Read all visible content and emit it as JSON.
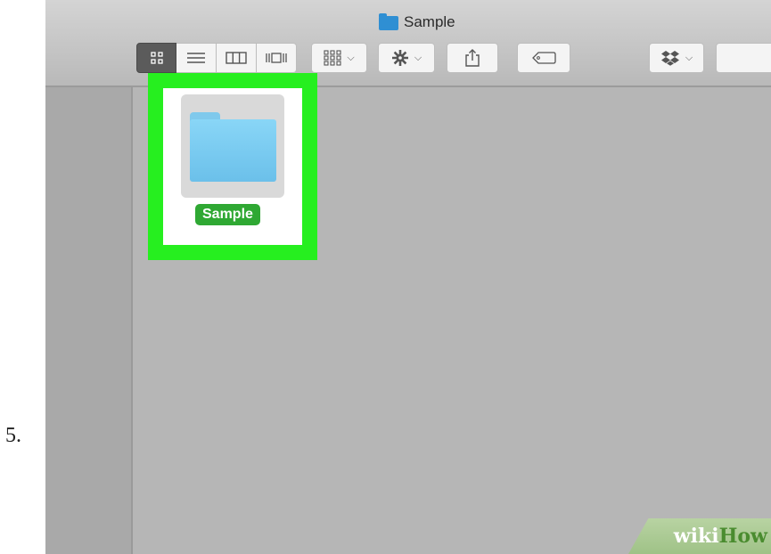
{
  "step_number": "5.",
  "window": {
    "title": "Sample",
    "toolbar": {
      "view_icon": "icon-view-button",
      "list_icon": "list-view-button",
      "column_icon": "column-view-button",
      "gallery_icon": "cover-flow-button",
      "arrange_icon": "arrange-button",
      "action_icon": "gear-icon",
      "share_icon": "share-icon",
      "tag_icon": "tag-icon",
      "dropbox_icon": "dropbox-icon"
    },
    "item": {
      "label": "Sample",
      "icon": "folder-icon"
    }
  },
  "watermark": {
    "part1": "wiki",
    "part2": "How"
  },
  "colors": {
    "highlight": "#26ef1f",
    "label_bg": "#2fa833",
    "folder": "#7fc9ec"
  }
}
